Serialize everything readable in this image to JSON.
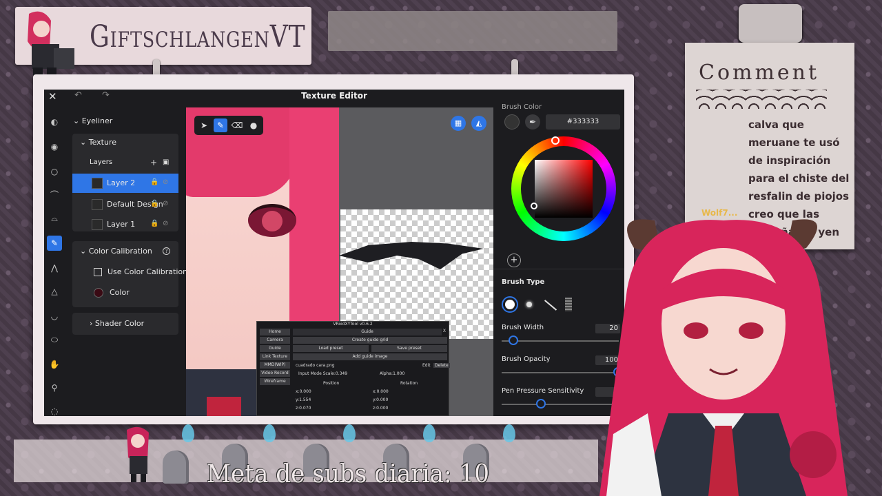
{
  "stream": {
    "channel_name": "GiftschlangenVT",
    "subs_goal": "Meta de subs diaria: 10"
  },
  "comment_panel": {
    "title": "Comment",
    "username": "Wolf7...",
    "message": "calva que meruane te usó de inspiración para el chiste del resfalin de piojos creo que las pestañas si yen"
  },
  "editor": {
    "window_title": "Texture Editor",
    "panel": {
      "eyeliner": "Eyeliner",
      "texture": "Texture",
      "layers_label": "Layers",
      "layers": [
        {
          "label": "Layer 2",
          "selected": true
        },
        {
          "label": "Default Design",
          "selected": false
        },
        {
          "label": "Layer 1",
          "selected": false
        }
      ],
      "color_calibration": "Color Calibration",
      "use_color_calibration": "Use Color Calibration",
      "color_label": "Color",
      "shader_color": "Shader Color"
    },
    "brush": {
      "brush_color_label": "Brush Color",
      "hex": "#333333",
      "brush_type": "Brush Type",
      "brush_width_label": "Brush Width",
      "brush_width": "20",
      "brush_opacity_label": "Brush Opacity",
      "brush_opacity": "100",
      "pen_pressure_label": "Pen Pressure Sensitivity"
    },
    "vroid_tool": {
      "title": "VRoidXYTool v0.6.2",
      "close": "X",
      "nav": [
        "Home",
        "Camera",
        "Guide",
        "Link Texture",
        "MMD(WIP)",
        "Video Record",
        "Wireframe"
      ],
      "header": "Guide",
      "create_guide_grid": "Create guide grid",
      "load_preset": "Load preset",
      "save_preset": "Save preset",
      "add_guide_image": "Add guide image",
      "file": "cuadrado cara.png",
      "edit": "Edit",
      "delete": "Delete",
      "input_mode": "Input Mode Scale:0.349",
      "alpha": "Alpha:1.000",
      "position_label": "Position",
      "rotation_label": "Rotation",
      "pos_x": "x:0.000",
      "pos_y": "y:1.554",
      "pos_z": "z:0.070",
      "rot_x": "x:0.000",
      "rot_y": "y:0.000",
      "rot_z": "z:0.000"
    }
  },
  "colors": {
    "accent": "#2f76e6",
    "panel": "#1c1c1f",
    "selected_color_swatch": "#3a0a14"
  },
  "icons": [
    "close-icon",
    "undo-icon",
    "redo-icon",
    "select-icon",
    "pen-icon",
    "eraser-icon",
    "fill-icon",
    "grid-icon",
    "mirror-icon",
    "eyedropper-icon",
    "add-icon",
    "lock-icon",
    "eye-hidden-icon",
    "help-icon"
  ]
}
